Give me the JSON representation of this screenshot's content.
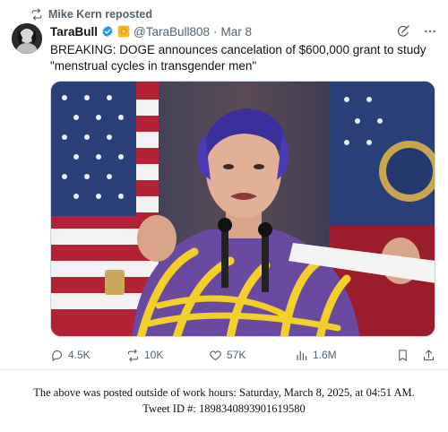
{
  "repost": {
    "label": "Mike Kern reposted",
    "icon": "repost-icon"
  },
  "author": {
    "name": "TaraBull",
    "handle": "@TaraBull808",
    "separator": "·",
    "date": "Mar 8",
    "verified_icon": "verified-badge-icon",
    "affiliate_icon": "affiliate-badge-icon",
    "verified_color": "#1d9bf0"
  },
  "header_actions": {
    "grok_icon": "grok-icon",
    "more_icon": "more-icon"
  },
  "tweet": {
    "text": "BREAKING: DOGE announces cancelation of $600,000 grant to study \"menstrual cycles in transgender men\""
  },
  "media": {
    "description_icon": "photo"
  },
  "actions": {
    "replies": "4.5K",
    "reposts": "10K",
    "likes": "57K",
    "views": "1.6M"
  },
  "footer": {
    "line1": "The above was posted outside of work hours: Saturday, March 8, 2025, at 04:51 AM.",
    "line2": "Tweet ID #: 1898340893901619580"
  }
}
